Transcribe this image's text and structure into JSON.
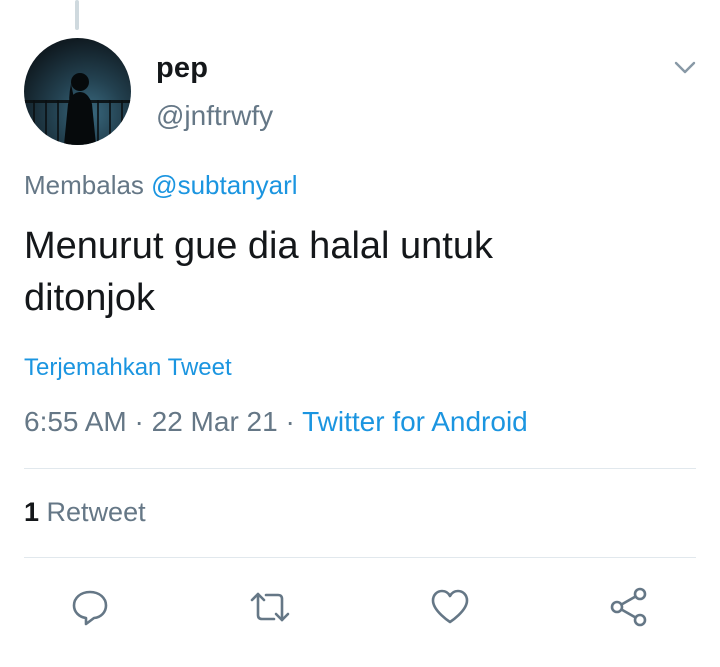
{
  "tweet": {
    "display_name": "pep",
    "handle": "@jnftrwfy",
    "reply_prefix": "Membalas",
    "reply_to": "@subtanyarl",
    "text_line1": "Menurut gue dia halal untuk",
    "text_line2": "ditonjok",
    "translate_label": "Terjemahkan Tweet",
    "time": "6:55 AM",
    "separator": "·",
    "date": "22 Mar 21",
    "source": "Twitter for Android"
  },
  "stats": {
    "retweet_count": "1",
    "retweet_label": "Retweet"
  },
  "actions": {
    "icons": [
      "reply-icon",
      "retweet-icon",
      "like-icon",
      "share-icon"
    ]
  },
  "colors": {
    "link": "#1b95e0",
    "secondary_text": "#657786",
    "primary_text": "#14171a",
    "divider": "#e1e8ed"
  }
}
